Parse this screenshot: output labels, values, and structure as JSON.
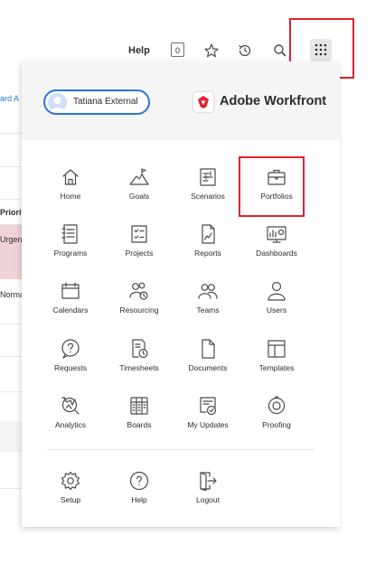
{
  "header": {
    "help_label": "Help",
    "notification_count": "0",
    "icons": [
      "star-icon",
      "history-icon",
      "search-icon",
      "grid-launcher-icon"
    ]
  },
  "background": {
    "link_fragment": "ard A",
    "column_header_fragment": "Priorit",
    "urgent_fragment": "Urgen",
    "normal_fragment": "Norma"
  },
  "menu": {
    "user": {
      "name": "Tatiana External"
    },
    "brand": {
      "name": "Adobe Workfront"
    },
    "items": [
      {
        "label": "Home",
        "icon": "home-icon"
      },
      {
        "label": "Goals",
        "icon": "goals-icon"
      },
      {
        "label": "Scenarios",
        "icon": "scenarios-icon"
      },
      {
        "label": "Portfolios",
        "icon": "portfolios-icon"
      },
      {
        "label": "Programs",
        "icon": "programs-icon"
      },
      {
        "label": "Projects",
        "icon": "projects-icon"
      },
      {
        "label": "Reports",
        "icon": "reports-icon"
      },
      {
        "label": "Dashboards",
        "icon": "dashboards-icon"
      },
      {
        "label": "Calendars",
        "icon": "calendars-icon"
      },
      {
        "label": "Resourcing",
        "icon": "resourcing-icon"
      },
      {
        "label": "Teams",
        "icon": "teams-icon"
      },
      {
        "label": "Users",
        "icon": "users-icon"
      },
      {
        "label": "Requests",
        "icon": "requests-icon"
      },
      {
        "label": "Timesheets",
        "icon": "timesheets-icon"
      },
      {
        "label": "Documents",
        "icon": "documents-icon"
      },
      {
        "label": "Templates",
        "icon": "templates-icon"
      },
      {
        "label": "Analytics",
        "icon": "analytics-icon"
      },
      {
        "label": "Boards",
        "icon": "boards-icon"
      },
      {
        "label": "My Updates",
        "icon": "my-updates-icon"
      },
      {
        "label": "Proofing",
        "icon": "proofing-icon"
      }
    ],
    "footer": [
      {
        "label": "Setup",
        "icon": "setup-icon"
      },
      {
        "label": "Help",
        "icon": "help-icon"
      },
      {
        "label": "Logout",
        "icon": "logout-icon"
      }
    ]
  },
  "colors": {
    "highlight": "#e4212b",
    "accent": "#2b72e6",
    "brand_red": "#e4212b"
  }
}
